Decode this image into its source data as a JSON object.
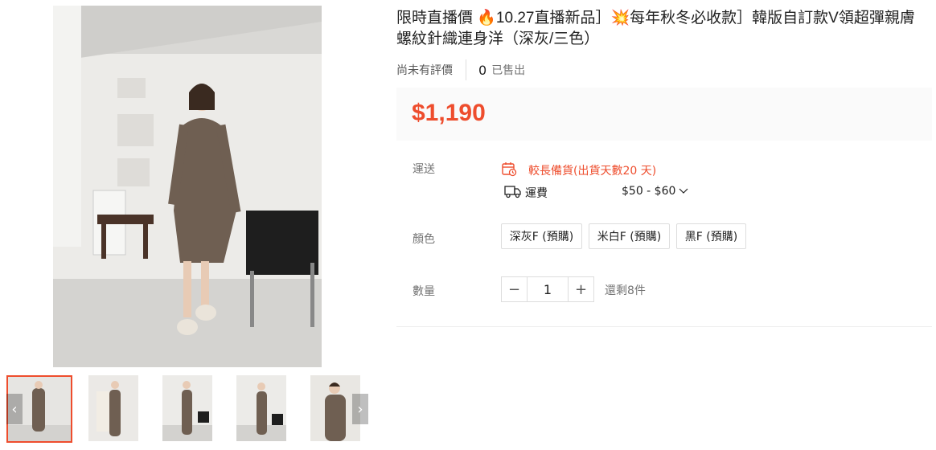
{
  "product": {
    "title": "限時直播價 🔥10.27直播新品］💥每年秋冬必收款］韓版自訂款V領超彈親膚螺紋針織連身洋（深灰/三色）",
    "rating_text": "尚未有評價",
    "sold_count": "0",
    "sold_label": "已售出",
    "price": "$1,190"
  },
  "shipping": {
    "label": "運送",
    "preorder_text": "較長備貨(出貨天數20 天)",
    "fee_label": "運費",
    "fee_range": "$50 - $60"
  },
  "color": {
    "label": "顏色",
    "options": [
      "深灰F (預購)",
      "米白F (預購)",
      "黑F (預購)"
    ]
  },
  "quantity": {
    "label": "數量",
    "minus": "−",
    "value": "1",
    "plus": "+",
    "stock_text": "還剩8件"
  },
  "gallery": {
    "prev": "‹",
    "next": "›",
    "thumbnail_count": 5,
    "active_index": 0
  },
  "colors": {
    "accent": "#ee4d2d",
    "price_bg": "#fafafa",
    "dress": "#6f5f52"
  }
}
